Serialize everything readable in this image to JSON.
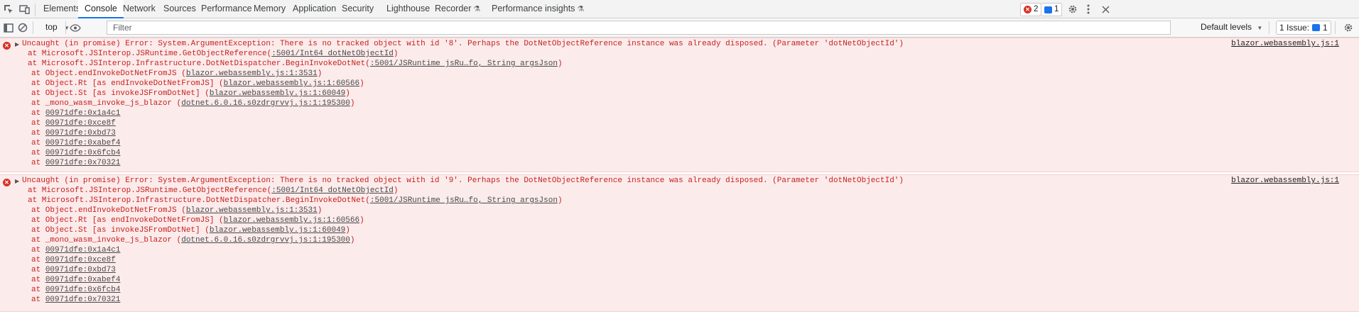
{
  "tabs": [
    "Elements",
    "Console",
    "Network",
    "Sources",
    "Performance",
    "Memory",
    "Application",
    "Security",
    "Lighthouse",
    "Recorder",
    "Performance insights"
  ],
  "badges": {
    "errors": "2",
    "messages": "1"
  },
  "toolbar": {
    "context": "top",
    "filter_placeholder": "Filter",
    "levels": "Default levels",
    "issues_label": "1 Issue:",
    "issues_count": "1"
  },
  "messages": [
    {
      "text": "Uncaught (in promise) Error: System.ArgumentException: There is no tracked object with id '8'. Perhaps the DotNetObjectReference instance was already disposed. (Parameter 'dotNetObjectId')",
      "source": "blazor.webassembly.js:1",
      "stack": [
        {
          "pre": "at Microsoft.JSInterop.JSRuntime.GetObjectReference(",
          "link": ":5001/Int64 dotNetObjectId",
          "post": ")"
        },
        {
          "pre": "at Microsoft.JSInterop.Infrastructure.DotNetDispatcher.BeginInvokeDotNet(",
          "link": ":5001/JSRuntime jsRu…fo, String argsJson",
          "post": ")"
        },
        {
          "pre": "at Object.endInvokeDotNetFromJS (",
          "link": "blazor.webassembly.js:1:3531",
          "post": ")"
        },
        {
          "pre": "at Object.Rt [as endInvokeDotNetFromJS] (",
          "link": "blazor.webassembly.js:1:60566",
          "post": ")"
        },
        {
          "pre": "at Object.St [as invokeJSFromDotNet] (",
          "link": "blazor.webassembly.js:1:60049",
          "post": ")"
        },
        {
          "pre": "at _mono_wasm_invoke_js_blazor (",
          "link": "dotnet.6.0.16.s0zdrgrvvj.js:1:195300",
          "post": ")"
        },
        {
          "pre": "at ",
          "link": "00971dfe:0x1a4c1",
          "post": ""
        },
        {
          "pre": "at ",
          "link": "00971dfe:0xce8f",
          "post": ""
        },
        {
          "pre": "at ",
          "link": "00971dfe:0xbd73",
          "post": ""
        },
        {
          "pre": "at ",
          "link": "00971dfe:0xabef4",
          "post": ""
        },
        {
          "pre": "at ",
          "link": "00971dfe:0x6fcb4",
          "post": ""
        },
        {
          "pre": "at ",
          "link": "00971dfe:0x70321",
          "post": ""
        }
      ]
    },
    {
      "text": "Uncaught (in promise) Error: System.ArgumentException: There is no tracked object with id '9'. Perhaps the DotNetObjectReference instance was already disposed. (Parameter 'dotNetObjectId')",
      "source": "blazor.webassembly.js:1",
      "stack": [
        {
          "pre": "at Microsoft.JSInterop.JSRuntime.GetObjectReference(",
          "link": ":5001/Int64 dotNetObjectId",
          "post": ")"
        },
        {
          "pre": "at Microsoft.JSInterop.Infrastructure.DotNetDispatcher.BeginInvokeDotNet(",
          "link": ":5001/JSRuntime jsRu…fo, String argsJson",
          "post": ")"
        },
        {
          "pre": "at Object.endInvokeDotNetFromJS (",
          "link": "blazor.webassembly.js:1:3531",
          "post": ")"
        },
        {
          "pre": "at Object.Rt [as endInvokeDotNetFromJS] (",
          "link": "blazor.webassembly.js:1:60566",
          "post": ")"
        },
        {
          "pre": "at Object.St [as invokeJSFromDotNet] (",
          "link": "blazor.webassembly.js:1:60049",
          "post": ")"
        },
        {
          "pre": "at _mono_wasm_invoke_js_blazor (",
          "link": "dotnet.6.0.16.s0zdrgrvvj.js:1:195300",
          "post": ")"
        },
        {
          "pre": "at ",
          "link": "00971dfe:0x1a4c1",
          "post": ""
        },
        {
          "pre": "at ",
          "link": "00971dfe:0xce8f",
          "post": ""
        },
        {
          "pre": "at ",
          "link": "00971dfe:0xbd73",
          "post": ""
        },
        {
          "pre": "at ",
          "link": "00971dfe:0xabef4",
          "post": ""
        },
        {
          "pre": "at ",
          "link": "00971dfe:0x6fcb4",
          "post": ""
        },
        {
          "pre": "at ",
          "link": "00971dfe:0x70321",
          "post": ""
        }
      ]
    }
  ]
}
